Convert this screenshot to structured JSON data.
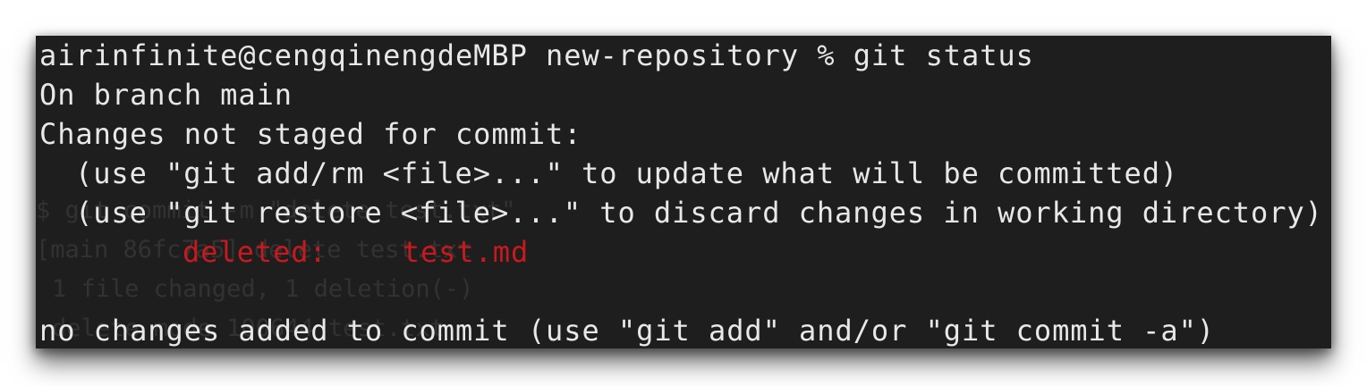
{
  "terminal": {
    "prompt_line": "airinfinite@cengqinengdeMBP new-repository % git status",
    "branch_line": "On branch main",
    "changes_header": "Changes not staged for commit:",
    "hint_add": "(use \"git add/rm <file>...\" to update what will be committed)",
    "hint_restore": "(use \"git restore <file>...\" to discard changes in working directory)",
    "deleted_label": "deleted:",
    "deleted_file": "test.md",
    "no_changes_line": "no changes added to commit (use \"git add\" and/or \"git commit -a\")"
  },
  "background_ghost_text": {
    "line_1": "$ git commit -m \"delete test.txt\"",
    "line_2": "[main 86fc7a5] delete test.txt",
    "line_3": "1 file changed, 1 deletion(-)",
    "line_4": "delete mode 100644 test.txt"
  },
  "colors": {
    "terminal_bg": "#1e1e1e",
    "text": "#e8e8e8",
    "deleted": "#c8191e"
  }
}
